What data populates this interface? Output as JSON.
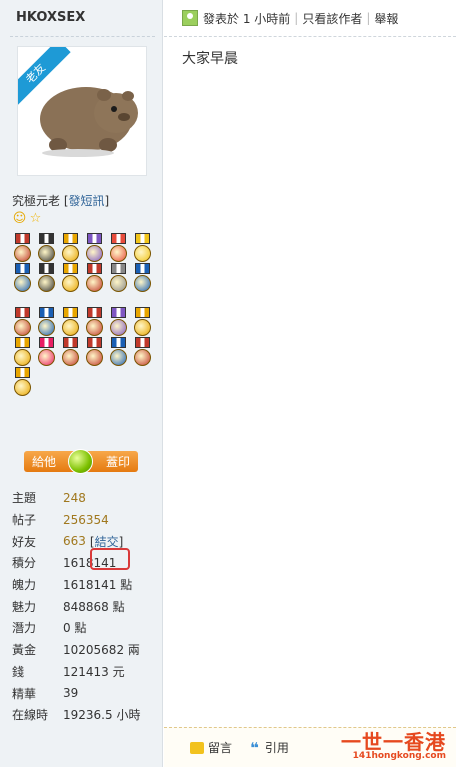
{
  "sidebar": {
    "username": "HKOXSEX",
    "avatar_badge": "老友",
    "rank": "究極元老",
    "send_message": "發短訊",
    "give_button": {
      "left": "給他",
      "right": "蓋印"
    },
    "stats": [
      {
        "label": "主題",
        "value": "248"
      },
      {
        "label": "帖子",
        "value": "256354"
      },
      {
        "label": "好友",
        "value": "663",
        "action": "結交"
      },
      {
        "label": "積分",
        "value": "1618141"
      },
      {
        "label": "魄力",
        "value": "1618141 點"
      },
      {
        "label": "魅力",
        "value": "848868 點"
      },
      {
        "label": "潛力",
        "value": "0 點"
      },
      {
        "label": "黃金",
        "value": "10205682 兩"
      },
      {
        "label": "錢",
        "value": "121413 元"
      },
      {
        "label": "精華",
        "value": "39"
      },
      {
        "label": "在線時",
        "value": "19236.5 小時"
      }
    ],
    "medal_rows": [
      [
        "#c0392b",
        "#333333",
        "#e8a600",
        "#7e57c2",
        "#e74c3c",
        "#f0c419"
      ],
      [
        "#1a5fb4",
        "#333333",
        "#e8a600",
        "#c0392b",
        "#888888",
        "#1a5fb4"
      ],
      [
        "#c0392b",
        "#1a5fb4",
        "#e8a600",
        "#c0392b",
        "#7e57c2",
        "#e8a600"
      ],
      [
        "#e8a600",
        "#e91e63",
        "#c0392b",
        "#c0392b",
        "#1a5fb4",
        "#c0392b"
      ],
      [
        "#e8a600"
      ]
    ]
  },
  "post": {
    "posted": "發表於 1 小時前",
    "only_author": "只看該作者",
    "report": "舉報",
    "content": "大家早晨",
    "reply": "留言",
    "quote": "引用"
  },
  "watermark": {
    "title": "一世一香港",
    "url": "141hongkong.com"
  }
}
